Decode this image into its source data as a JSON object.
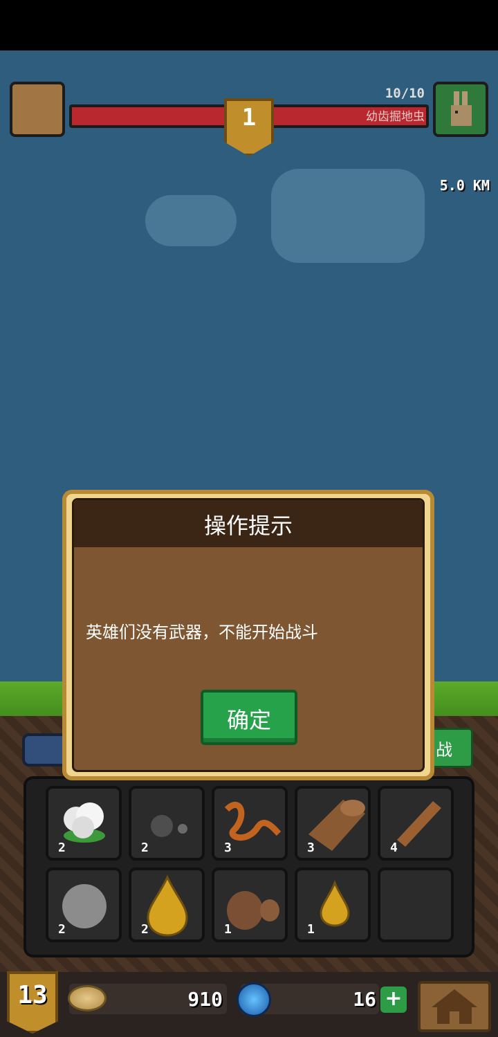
{
  "hud": {
    "level": "1",
    "enemy_hp": "10/10",
    "enemy_name": "幼齿掘地虫",
    "distance": "5.0 KM"
  },
  "dialog": {
    "title": "操作提示",
    "message": "英雄们没有武器，不能开始战斗",
    "confirm_label": "确定"
  },
  "background_button": {
    "battle_label": "战"
  },
  "inventory": [
    {
      "icon": "cotton-icon",
      "count": "2"
    },
    {
      "icon": "stone-pellets-icon",
      "count": "2"
    },
    {
      "icon": "rope-icon",
      "count": "3"
    },
    {
      "icon": "wood-log-icon",
      "count": "3"
    },
    {
      "icon": "stick-icon",
      "count": "4"
    },
    {
      "icon": "stone-icon",
      "count": "2"
    },
    {
      "icon": "oil-drop-icon",
      "count": "2"
    },
    {
      "icon": "clay-icon",
      "count": "1"
    },
    {
      "icon": "small-oil-drop-icon",
      "count": "1"
    },
    {
      "icon": "empty-slot",
      "count": ""
    }
  ],
  "bottom_bar": {
    "player_level": "13",
    "coins": "910",
    "gems": "16",
    "add_symbol": "+"
  }
}
